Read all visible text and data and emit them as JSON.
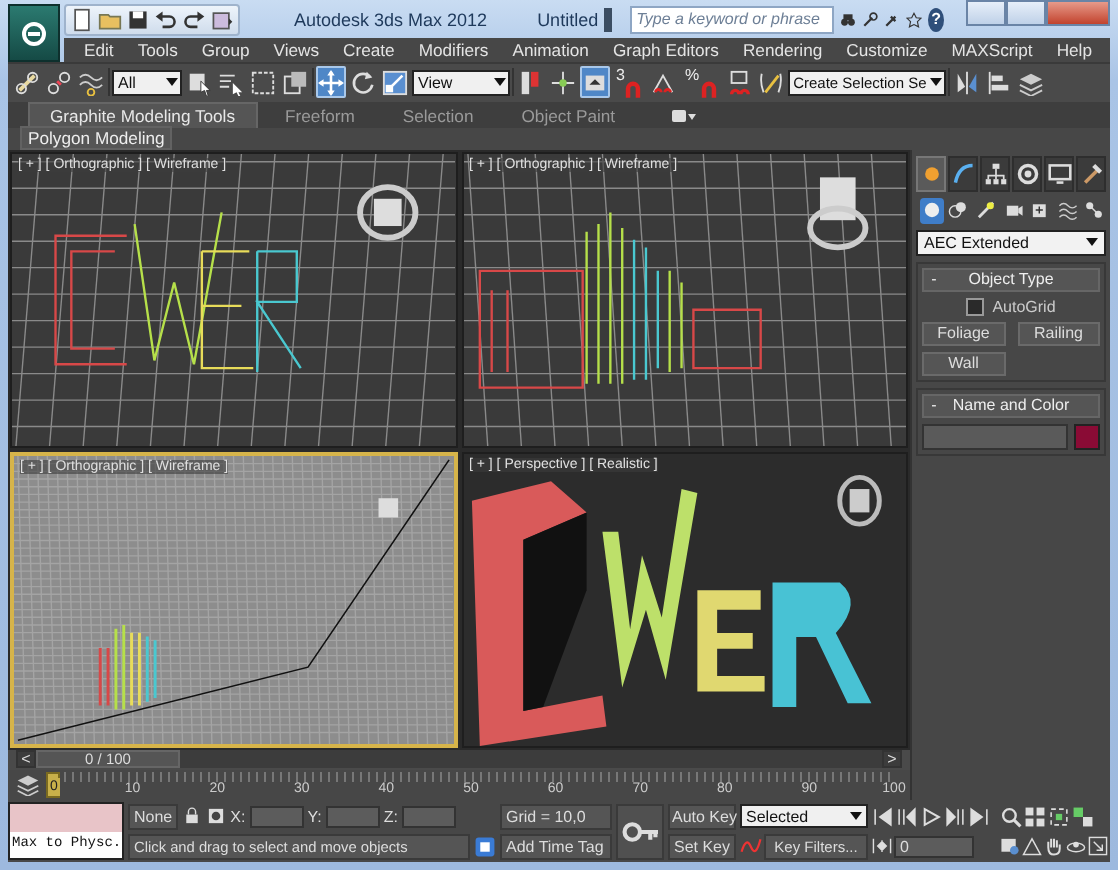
{
  "title_bar": {
    "app": "Autodesk 3ds Max  2012",
    "document": "Untitled",
    "search": {
      "placeholder": "Type a keyword or phrase"
    },
    "help": "?"
  },
  "menu": [
    "Edit",
    "Tools",
    "Group",
    "Views",
    "Create",
    "Modifiers",
    "Animation",
    "Graph Editors",
    "Rendering",
    "Customize",
    "MAXScript",
    "Help"
  ],
  "toolbar": [
    {
      "kind": "link",
      "selected": false
    },
    {
      "kind": "unlink",
      "selected": false
    },
    {
      "kind": "bind",
      "selected": false
    },
    {
      "kind": "dropdown",
      "value": "All",
      "selected": false
    },
    {
      "kind": "select",
      "selected": false
    },
    {
      "kind": "select_name",
      "selected": false
    },
    {
      "kind": "region",
      "selected": false
    },
    {
      "kind": "crossing",
      "selected": false
    },
    {
      "kind": "move",
      "selected": true
    },
    {
      "kind": "rotate",
      "selected": false
    },
    {
      "kind": "scale",
      "selected": false
    },
    {
      "kind": "dropdown",
      "value": "View",
      "selected": false
    },
    {
      "kind": "pivot",
      "selected": false
    },
    {
      "kind": "manipulate",
      "selected": false
    },
    {
      "kind": "keyboard",
      "selected": true
    },
    {
      "kind": "snap",
      "label": "3",
      "selected": false
    },
    {
      "kind": "angle",
      "selected": false
    },
    {
      "kind": "snap",
      "label": "%",
      "selected": false
    },
    {
      "kind": "spinner",
      "selected": false
    },
    {
      "kind": "named_sel",
      "selected": false
    },
    {
      "kind": "dropdown",
      "value": "Create Selection Se",
      "selected": false
    },
    {
      "kind": "mirror",
      "selected": false
    },
    {
      "kind": "align",
      "selected": false
    },
    {
      "kind": "layers",
      "selected": false
    }
  ],
  "ribbon": {
    "tabs": [
      {
        "label": "Graphite Modeling Tools",
        "selected": true
      },
      {
        "label": "Freeform",
        "selected": false
      },
      {
        "label": "Selection",
        "selected": false
      },
      {
        "label": "Object Paint",
        "selected": false
      }
    ],
    "panel": "Polygon Modeling"
  },
  "viewports": [
    {
      "label": "[ + ] [ Orthographic ] [ Wireframe ]",
      "kind": "front",
      "active": false
    },
    {
      "label": "[ + ] [ Orthographic ] [ Wireframe ]",
      "kind": "side",
      "active": false
    },
    {
      "label": "[ + ] [ Orthographic ] [ Wireframe ]",
      "kind": "dense",
      "active": true
    },
    {
      "label": "[ + ] [ Perspective ] [ Realistic ]",
      "kind": "shaded",
      "active": false
    }
  ],
  "command_panel": {
    "tabs": [
      {
        "kind": "create",
        "selected": true
      },
      {
        "kind": "modify",
        "selected": false
      },
      {
        "kind": "hierarchy",
        "selected": false
      },
      {
        "kind": "motion",
        "selected": false
      },
      {
        "kind": "display",
        "selected": false
      },
      {
        "kind": "utilities",
        "selected": false
      }
    ],
    "categories": [
      {
        "kind": "geometry",
        "selected": true
      },
      {
        "kind": "shapes",
        "selected": false
      },
      {
        "kind": "lights",
        "selected": false
      },
      {
        "kind": "cameras",
        "selected": false
      },
      {
        "kind": "helpers",
        "selected": false
      },
      {
        "kind": "spacewarps",
        "selected": false
      },
      {
        "kind": "systems",
        "selected": false
      }
    ],
    "dropdown": "AEC Extended",
    "rollouts": [
      {
        "kind": "object_type",
        "toggle": "-",
        "title": "Object Type",
        "autogrid": {
          "label": "AutoGrid",
          "checked": false
        },
        "buttons": [
          "Foliage",
          "Railing",
          "Wall"
        ]
      },
      {
        "kind": "name_color",
        "toggle": "-",
        "title": "Name and Color",
        "color": "#8a0b35"
      }
    ]
  },
  "time_slider": {
    "prev": "<",
    "position": "0 / 100",
    "next": ">",
    "level": 0
  },
  "track_bar": {
    "ticks": [
      "0",
      "10",
      "20",
      "30",
      "40",
      "50",
      "60",
      "70",
      "80",
      "90",
      "100"
    ]
  },
  "status": {
    "listener": "Max to Physc.",
    "selection": "None",
    "x_label": "X:",
    "y_label": "Y:",
    "z_label": "Z:",
    "grid": "Grid = 10,0",
    "prompt": "Click and drag to select and move objects",
    "time_tag": "Add Time Tag",
    "auto_key": "Auto Key",
    "key_mode": "Selected",
    "set_key": "Set Key",
    "key_filters": "Key Filters...",
    "frame": "0"
  }
}
